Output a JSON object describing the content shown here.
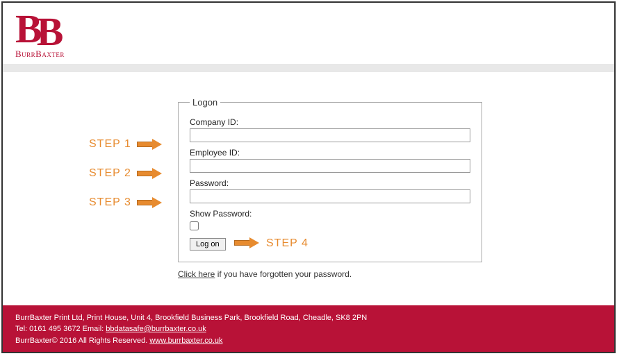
{
  "brand": {
    "name": "BurrBaxter"
  },
  "logon": {
    "legend": "Logon",
    "company_label": "Company ID:",
    "employee_label": "Employee ID:",
    "password_label": "Password:",
    "show_password_label": "Show Password:",
    "button_label": "Log on"
  },
  "forgot": {
    "link_text": "Click here",
    "rest_text": " if you have forgotten your password."
  },
  "steps": {
    "s1": "Step 1",
    "s2": "Step 2",
    "s3": "Step 3",
    "s4": "Step 4"
  },
  "footer": {
    "line1": "BurrBaxter Print Ltd, Print House, Unit 4, Brookfield Business Park, Brookfield Road, Cheadle, SK8 2PN",
    "line2_pre": "Tel: 0161 495 3672 Email: ",
    "email": "bbdatasafe@burrbaxter.co.uk",
    "line3_pre": "BurrBaxter© 2016 All Rights Reserved. ",
    "url": "www.burrbaxter.co.uk"
  }
}
